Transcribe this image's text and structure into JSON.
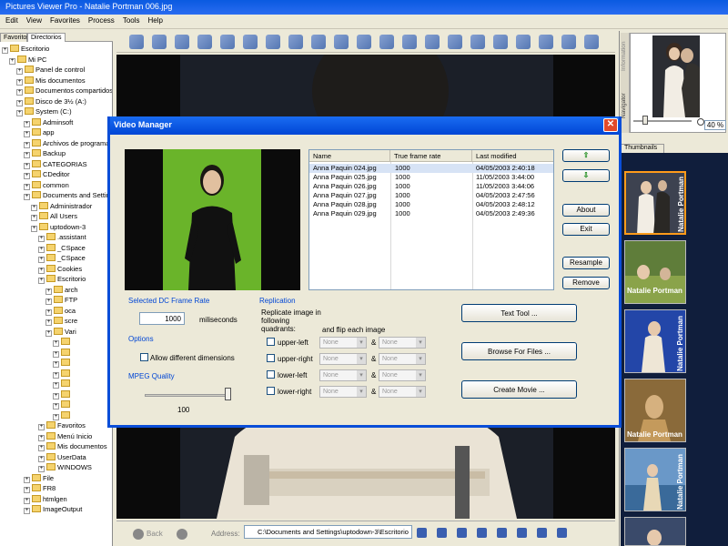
{
  "app": {
    "title": "Pictures Viewer Pro - Natalie Portman 006.jpg",
    "menus": [
      "Edit",
      "View",
      "Favorites",
      "Process",
      "Tools",
      "Help"
    ]
  },
  "panel": {
    "tabs": [
      "Favoritos",
      "Directorios"
    ]
  },
  "tree": [
    {
      "label": "Escritorio",
      "level": 0
    },
    {
      "label": "Mi PC",
      "level": 1
    },
    {
      "label": "Panel de control",
      "level": 2
    },
    {
      "label": "Mis documentos",
      "level": 2
    },
    {
      "label": "Documentos compartidos",
      "level": 2
    },
    {
      "label": "Disco de 3½ (A:)",
      "level": 2
    },
    {
      "label": "System (C:)",
      "level": 2
    },
    {
      "label": "Adminsoft",
      "level": 3
    },
    {
      "label": "app",
      "level": 3
    },
    {
      "label": "Archivos de programa",
      "level": 3
    },
    {
      "label": "Backup",
      "level": 3
    },
    {
      "label": "CATEGORIAS",
      "level": 3
    },
    {
      "label": "CDeditor",
      "level": 3
    },
    {
      "label": "common",
      "level": 3
    },
    {
      "label": "Documents and Settings",
      "level": 3
    },
    {
      "label": "Administrador",
      "level": 4
    },
    {
      "label": "All Users",
      "level": 4
    },
    {
      "label": "uptodown-3",
      "level": 4
    },
    {
      "label": ".assistant",
      "level": 5
    },
    {
      "label": "_CSpace",
      "level": 5
    },
    {
      "label": "_CSpace",
      "level": 5
    },
    {
      "label": "Cookies",
      "level": 5
    },
    {
      "label": "Escritorio",
      "level": 5
    },
    {
      "label": "arch",
      "level": 6
    },
    {
      "label": "FTP",
      "level": 6
    },
    {
      "label": "oca",
      "level": 6
    },
    {
      "label": "scre",
      "level": 6
    },
    {
      "label": "Vari",
      "level": 6
    },
    {
      "label": "",
      "level": 7
    },
    {
      "label": "",
      "level": 7
    },
    {
      "label": "",
      "level": 7
    },
    {
      "label": "",
      "level": 7
    },
    {
      "label": "",
      "level": 7
    },
    {
      "label": "",
      "level": 7
    },
    {
      "label": "",
      "level": 7
    },
    {
      "label": "",
      "level": 7
    },
    {
      "label": "Favoritos",
      "level": 5
    },
    {
      "label": "Menú Inicio",
      "level": 5
    },
    {
      "label": "Mis documentos",
      "level": 5
    },
    {
      "label": "UserData",
      "level": 5
    },
    {
      "label": "WINDOWS",
      "level": 5
    },
    {
      "label": "File",
      "level": 3
    },
    {
      "label": "FR8",
      "level": 3
    },
    {
      "label": "htmlgen",
      "level": 3
    },
    {
      "label": "ImageOutput",
      "level": 3
    }
  ],
  "navigator": {
    "zoom": "40 %",
    "side_tabs": [
      "Navigator",
      "Information"
    ]
  },
  "thumbnails": {
    "tab": "Thumbnails",
    "label": "Natalie Portman"
  },
  "statusbar": {
    "back_label": "Back",
    "address_label": "Address:",
    "address_value": "C:\\Documents and Settings\\uptodown-3\\Escritorio"
  },
  "dialog": {
    "title": "Video Manager",
    "list": {
      "columns": [
        "Name",
        "True frame rate",
        "Last modified"
      ],
      "rows": [
        {
          "name": "Anna Paquin 024.jpg",
          "rate": "1000",
          "modified": "04/05/2003 2:40:18"
        },
        {
          "name": "Anna Paquin 025.jpg",
          "rate": "1000",
          "modified": "11/05/2003 3:44:00"
        },
        {
          "name": "Anna Paquin 026.jpg",
          "rate": "1000",
          "modified": "11/05/2003 3:44:06"
        },
        {
          "name": "Anna Paquin 027.jpg",
          "rate": "1000",
          "modified": "04/05/2003 2:47:56"
        },
        {
          "name": "Anna Paquin 028.jpg",
          "rate": "1000",
          "modified": "04/05/2003 2:48:12"
        },
        {
          "name": "Anna Paquin 029.jpg",
          "rate": "1000",
          "modified": "04/05/2003 2:49:36"
        }
      ]
    },
    "buttons": {
      "about": "About",
      "exit": "Exit",
      "resample": "Resample",
      "remove": "Remove",
      "text_tool": "Text Tool ...",
      "browse": "Browse For Files ...",
      "create_movie": "Create Movie ..."
    },
    "frame_rate": {
      "title": "Selected DC Frame Rate",
      "value": "1000",
      "unit": "miliseconds"
    },
    "options": {
      "title": "Options",
      "allow_label": "Allow different dimensions",
      "allow_checked": false
    },
    "mpeg": {
      "title": "MPEG Quality",
      "value": "100",
      "level": 100
    },
    "replication": {
      "title": "Replication",
      "desc": "Replicate image in following quadrants:",
      "flip_label": "and flip each image",
      "rows": [
        {
          "label": "upper-left",
          "a": "None",
          "b": "None",
          "checked": false
        },
        {
          "label": "upper-right",
          "a": "None",
          "b": "None",
          "checked": false
        },
        {
          "label": "lower-left",
          "a": "None",
          "b": "None",
          "checked": false
        },
        {
          "label": "lower-right",
          "a": "None",
          "b": "None",
          "checked": false
        }
      ],
      "amp": "&"
    }
  },
  "colors": {
    "title_blue": "#0046d5",
    "thumb_bg": "#101e3c",
    "green_screen": "#6ab42a"
  }
}
